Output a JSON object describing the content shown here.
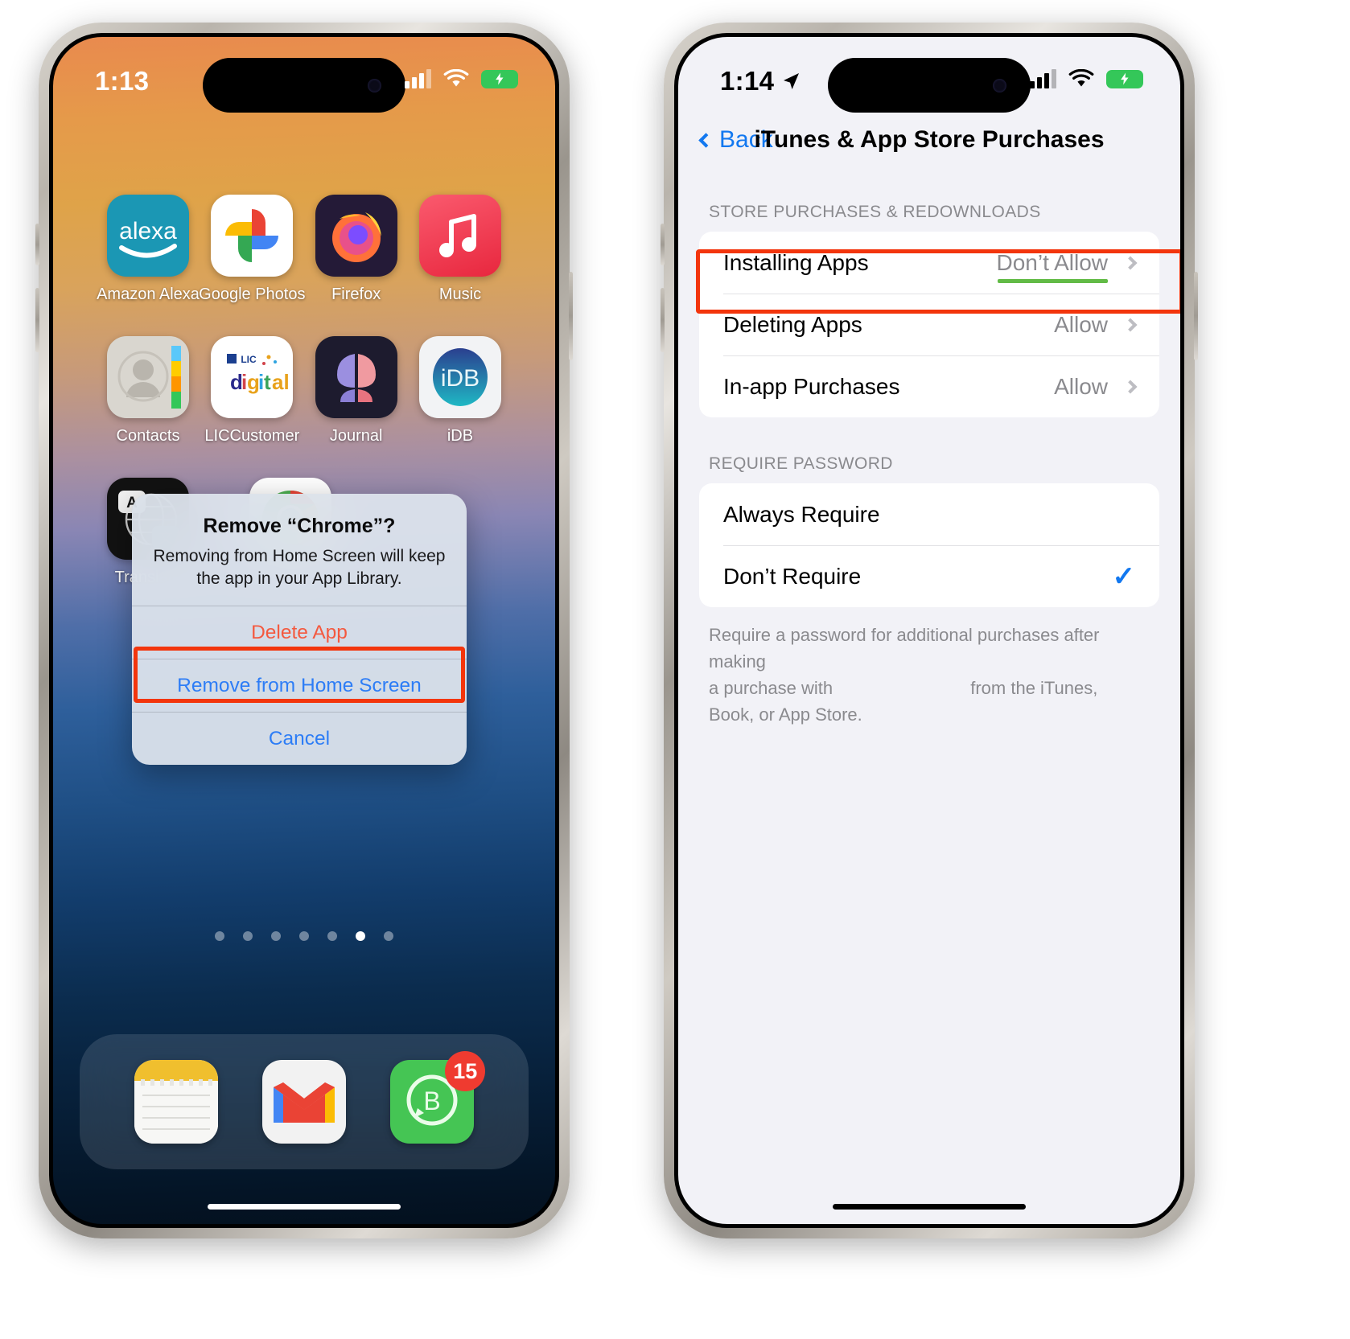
{
  "left_phone": {
    "status_bar": {
      "time": "1:13",
      "signal_icon": "cellular-signal-icon",
      "wifi_icon": "wifi-icon",
      "battery_icon": "battery-charging-icon"
    },
    "home_screen": {
      "rows": [
        [
          {
            "label": "Amazon Alexa",
            "icon": "amazon-alexa-icon"
          },
          {
            "label": "Google Photos",
            "icon": "google-photos-icon"
          },
          {
            "label": "Firefox",
            "icon": "firefox-icon"
          },
          {
            "label": "Music",
            "icon": "apple-music-icon"
          }
        ],
        [
          {
            "label": "Contacts",
            "icon": "contacts-icon"
          },
          {
            "label": "LICCustomer",
            "icon": "lic-digital-icon"
          },
          {
            "label": "Journal",
            "icon": "journal-icon"
          },
          {
            "label": "iDB",
            "icon": "idb-icon"
          }
        ],
        [
          {
            "label": "Translate",
            "icon": "translate-icon"
          },
          {
            "label": "Chrome",
            "icon": "google-chrome-icon"
          }
        ]
      ],
      "page_dots": {
        "total": 7,
        "active_index": 5
      },
      "dock": [
        {
          "label": "Notes",
          "icon": "notes-icon",
          "badge": ""
        },
        {
          "label": "Gmail",
          "icon": "gmail-icon",
          "badge": ""
        },
        {
          "label": "WhatsApp Business",
          "icon": "whatsapp-business-icon",
          "badge": "15"
        }
      ]
    },
    "alert": {
      "title": "Remove “Chrome”?",
      "message": "Removing from Home Screen will keep the app in your App Library.",
      "buttons": [
        {
          "label": "Delete App",
          "style": "destructive",
          "highlighted": true
        },
        {
          "label": "Remove from Home Screen",
          "style": "normal",
          "highlighted": false
        },
        {
          "label": "Cancel",
          "style": "normal",
          "highlighted": false
        }
      ]
    }
  },
  "right_phone": {
    "status_bar": {
      "time": "1:14",
      "location_icon": "location-arrow-icon",
      "signal_icon": "cellular-signal-icon",
      "wifi_icon": "wifi-icon",
      "battery_icon": "battery-charging-icon"
    },
    "nav": {
      "back_label": "Back",
      "back_icon": "chevron-left-icon",
      "title": "iTunes & App Store Purchases"
    },
    "sections": [
      {
        "header": "STORE PURCHASES & REDOWNLOADS",
        "rows": [
          {
            "label": "Installing Apps",
            "value": "Don’t Allow",
            "chevron": true,
            "highlighted": true,
            "underline": true
          },
          {
            "label": "Deleting Apps",
            "value": "Allow",
            "chevron": true,
            "highlighted": false,
            "underline": false
          },
          {
            "label": "In-app Purchases",
            "value": "Allow",
            "chevron": true,
            "highlighted": false,
            "underline": false
          }
        ]
      },
      {
        "header": "REQUIRE PASSWORD",
        "rows": [
          {
            "label": "Always Require",
            "value": "",
            "chevron": false,
            "checked": false
          },
          {
            "label": "Don’t Require",
            "value": "",
            "chevron": false,
            "checked": true
          }
        ],
        "footnote_lines": [
          "Require a password for additional purchases after making",
          "a purchase with                            from the iTunes,",
          "Book, or App Store."
        ]
      }
    ]
  },
  "colors": {
    "accent_blue": "#1278f0",
    "destructive_red": "#f4593f",
    "highlight_red": "#f3350c",
    "underline_green": "#62bb46",
    "badge_red": "#ef3b30",
    "settings_bg": "#f2f2f7"
  }
}
